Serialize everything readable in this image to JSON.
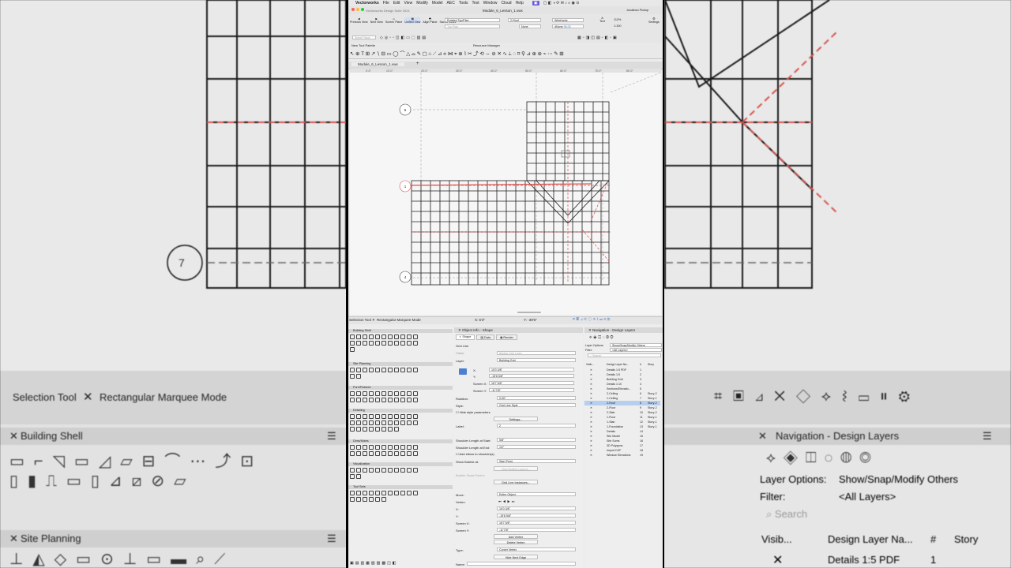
{
  "macos_menu": {
    "app": "Vectorworks",
    "items": [
      "File",
      "Edit",
      "View",
      "Modify",
      "Model",
      "AEC",
      "Tools",
      "Text",
      "Window",
      "Cloud",
      "Help"
    ]
  },
  "titlebar": {
    "app_title": "Vectorworks Design Suite 2024",
    "doc_title": "Module_6_Lesson_1.vwx",
    "user": "Jonathan Pickup"
  },
  "toolbar": {
    "view_buttons": [
      "Previous View",
      "Next View",
      "Screen Plane",
      "Unified View",
      "Align Plane",
      "Saved Views"
    ],
    "view_select": "Rotated Top/Plan",
    "layer_select": "2-Roof",
    "class_select": "None",
    "render_select": "Wireframe",
    "zoom": "112%",
    "scale": "1:100",
    "view_label": "Top Plan",
    "text_label": "Text",
    "settings_label": "Settings",
    "elevation": "dNone",
    "elevation_value": "96.00",
    "sheet_layer": "Sheet Plane"
  },
  "palettes": {
    "tool_palette_title": "New Tool Palette",
    "resource_manager_title": "Resource Manager"
  },
  "document_tab": "Module_6_Lesson_1.vwx",
  "ruler_labels": [
    "0'-0\"",
    "10'-0\"",
    "20'-0\"",
    "30'-0\"",
    "40'-0\"",
    "50'-0\"",
    "60'-0\"",
    "70'-0\"",
    "80'-0\""
  ],
  "drawing": {
    "bubble_labels": [
      "5",
      "1",
      "4"
    ]
  },
  "status": {
    "tool": "Selection Tool",
    "mode": "Rectangular Marquee Mode",
    "x": "X: 6'3\"",
    "y": "Y: -39'6\""
  },
  "background": {
    "tool": "Selection Tool",
    "mode": "Rectangular Marquee Mode",
    "building_shell": "Building Shell",
    "site_planning": "Site Planning",
    "nav_title": "Navigation - Design Layers",
    "layer_options_label": "Layer Options:",
    "layer_options_value": "Show/Snap/Modify Others",
    "filter_label": "Filter:",
    "filter_value": "<All Layers>",
    "search_placeholder": "Search",
    "col_visibility": "Visib...",
    "col_name": "Design Layer Na...",
    "col_num": "#",
    "col_story": "Story",
    "first_layer": "Details 1:5 PDF",
    "first_layer_num": "1",
    "bubble": "7"
  },
  "tool_sets": [
    "Building Shell",
    "Site Planning",
    "Furn/Fixtures",
    "Detailing",
    "Dims/Notes",
    "Visualization",
    "Tool Sets"
  ],
  "object_info": {
    "title": "Object Info - Shape",
    "tabs": [
      "Shape",
      "Data",
      "Render"
    ],
    "object_type": "Grid Line",
    "class_label": "Class:",
    "class_value": "Bubble Grid Lines",
    "layer_label": "Layer:",
    "layer_value": "Building Grid",
    "x_label": "X:",
    "x_value": "10'0 3/8\"",
    "y_label": "Y:",
    "y_value": "-15'8 5/8\"",
    "sx_label": "Screen X:",
    "sx_value": "16'7 5/8\"",
    "sy_label": "Screen Y:",
    "sy_value": "-11'7/8\"",
    "rotation_label": "Rotation:",
    "rotation_value": "0.00°",
    "style_label": "Style:",
    "style_value": "Grid Line Style",
    "hide_style": "Hide style parameters",
    "settings_btn": "Settings...",
    "label_label": "Label:",
    "label_value": "2",
    "shoulder_start_label": "Shoulder Length at Start:",
    "shoulder_start_value": "5/8\"",
    "shoulder_end_label": "Shoulder Length at End:",
    "shoulder_end_value": "1/2\"",
    "allow_elbow": "Add elbow to shoulder(s)",
    "show_bubble_label": "Show Bubble at:",
    "show_bubble_value": "Start Point",
    "grid_bubble_layout": "Grid Bubble Layout...",
    "bubble_scale_label": "Bubble Scale Factor:",
    "grid_line_instances": "Grid Line Instances...",
    "move_label": "Move:",
    "move_value": "Entire Object",
    "vertex_label": "Vertex:",
    "vx_label": "X:",
    "vx_value": "10'0 3/8\"",
    "vy_label": "Y:",
    "vy_value": "-15'8 5/8\"",
    "vsx_label": "Screen X:",
    "vsx_value": "16'7 5/8\"",
    "vsy_label": "Screen Y:",
    "vsy_value": "-11'7/8\"",
    "add_vertex": "Add Vertex",
    "delete_vertex": "Delete Vertex",
    "type_label": "Type:",
    "type_value": "Corner Vertex",
    "hide_next_edge": "Hide Next Edge",
    "name_label": "Name:"
  },
  "navigation": {
    "title": "Navigation - Design Layers",
    "layer_options_label": "Layer Options:",
    "layer_options_value": "Show/Snap/Modify Others",
    "filter_label": "Filter:",
    "filter_value": "<All Layers>",
    "search_placeholder": "Search",
    "columns": [
      "Visib...",
      "Design Layer Na...",
      "#",
      "Story"
    ],
    "layers": [
      {
        "name": "Details 1:5 PDF",
        "num": "1",
        "story": ""
      },
      {
        "name": "Details 1:5",
        "num": "2",
        "story": ""
      },
      {
        "name": "Building Grid",
        "num": "3",
        "story": ""
      },
      {
        "name": "Details 1:10",
        "num": "4",
        "story": ""
      },
      {
        "name": "Sections/Elevatio...",
        "num": "5",
        "story": ""
      },
      {
        "name": "2-Ceiling",
        "num": "6",
        "story": "Story-2"
      },
      {
        "name": "1-Ceiling",
        "num": "7",
        "story": "Story-1"
      },
      {
        "name": "2-Roof",
        "num": "8",
        "story": "Story-2"
      },
      {
        "name": "2-Floor",
        "num": "9",
        "story": "Story-2"
      },
      {
        "name": "2-Slab",
        "num": "10",
        "story": "Story-2"
      },
      {
        "name": "1-Floor",
        "num": "11",
        "story": "Story-1"
      },
      {
        "name": "1-Slab",
        "num": "12",
        "story": "Story-1"
      },
      {
        "name": "1-Foundation",
        "num": "13",
        "story": "Story-1"
      },
      {
        "name": "Details",
        "num": "14",
        "story": ""
      },
      {
        "name": "Site Model",
        "num": "15",
        "story": ""
      },
      {
        "name": "Site Sums",
        "num": "16",
        "story": ""
      },
      {
        "name": "3D Polygons",
        "num": "17",
        "story": ""
      },
      {
        "name": "Import DXF",
        "num": "18",
        "story": ""
      },
      {
        "name": "Window Elevations",
        "num": "19",
        "story": ""
      }
    ]
  },
  "colors": {
    "accent": "#4a7fd1",
    "grid_red": "#d9534f",
    "selection": "#b7cfee"
  }
}
